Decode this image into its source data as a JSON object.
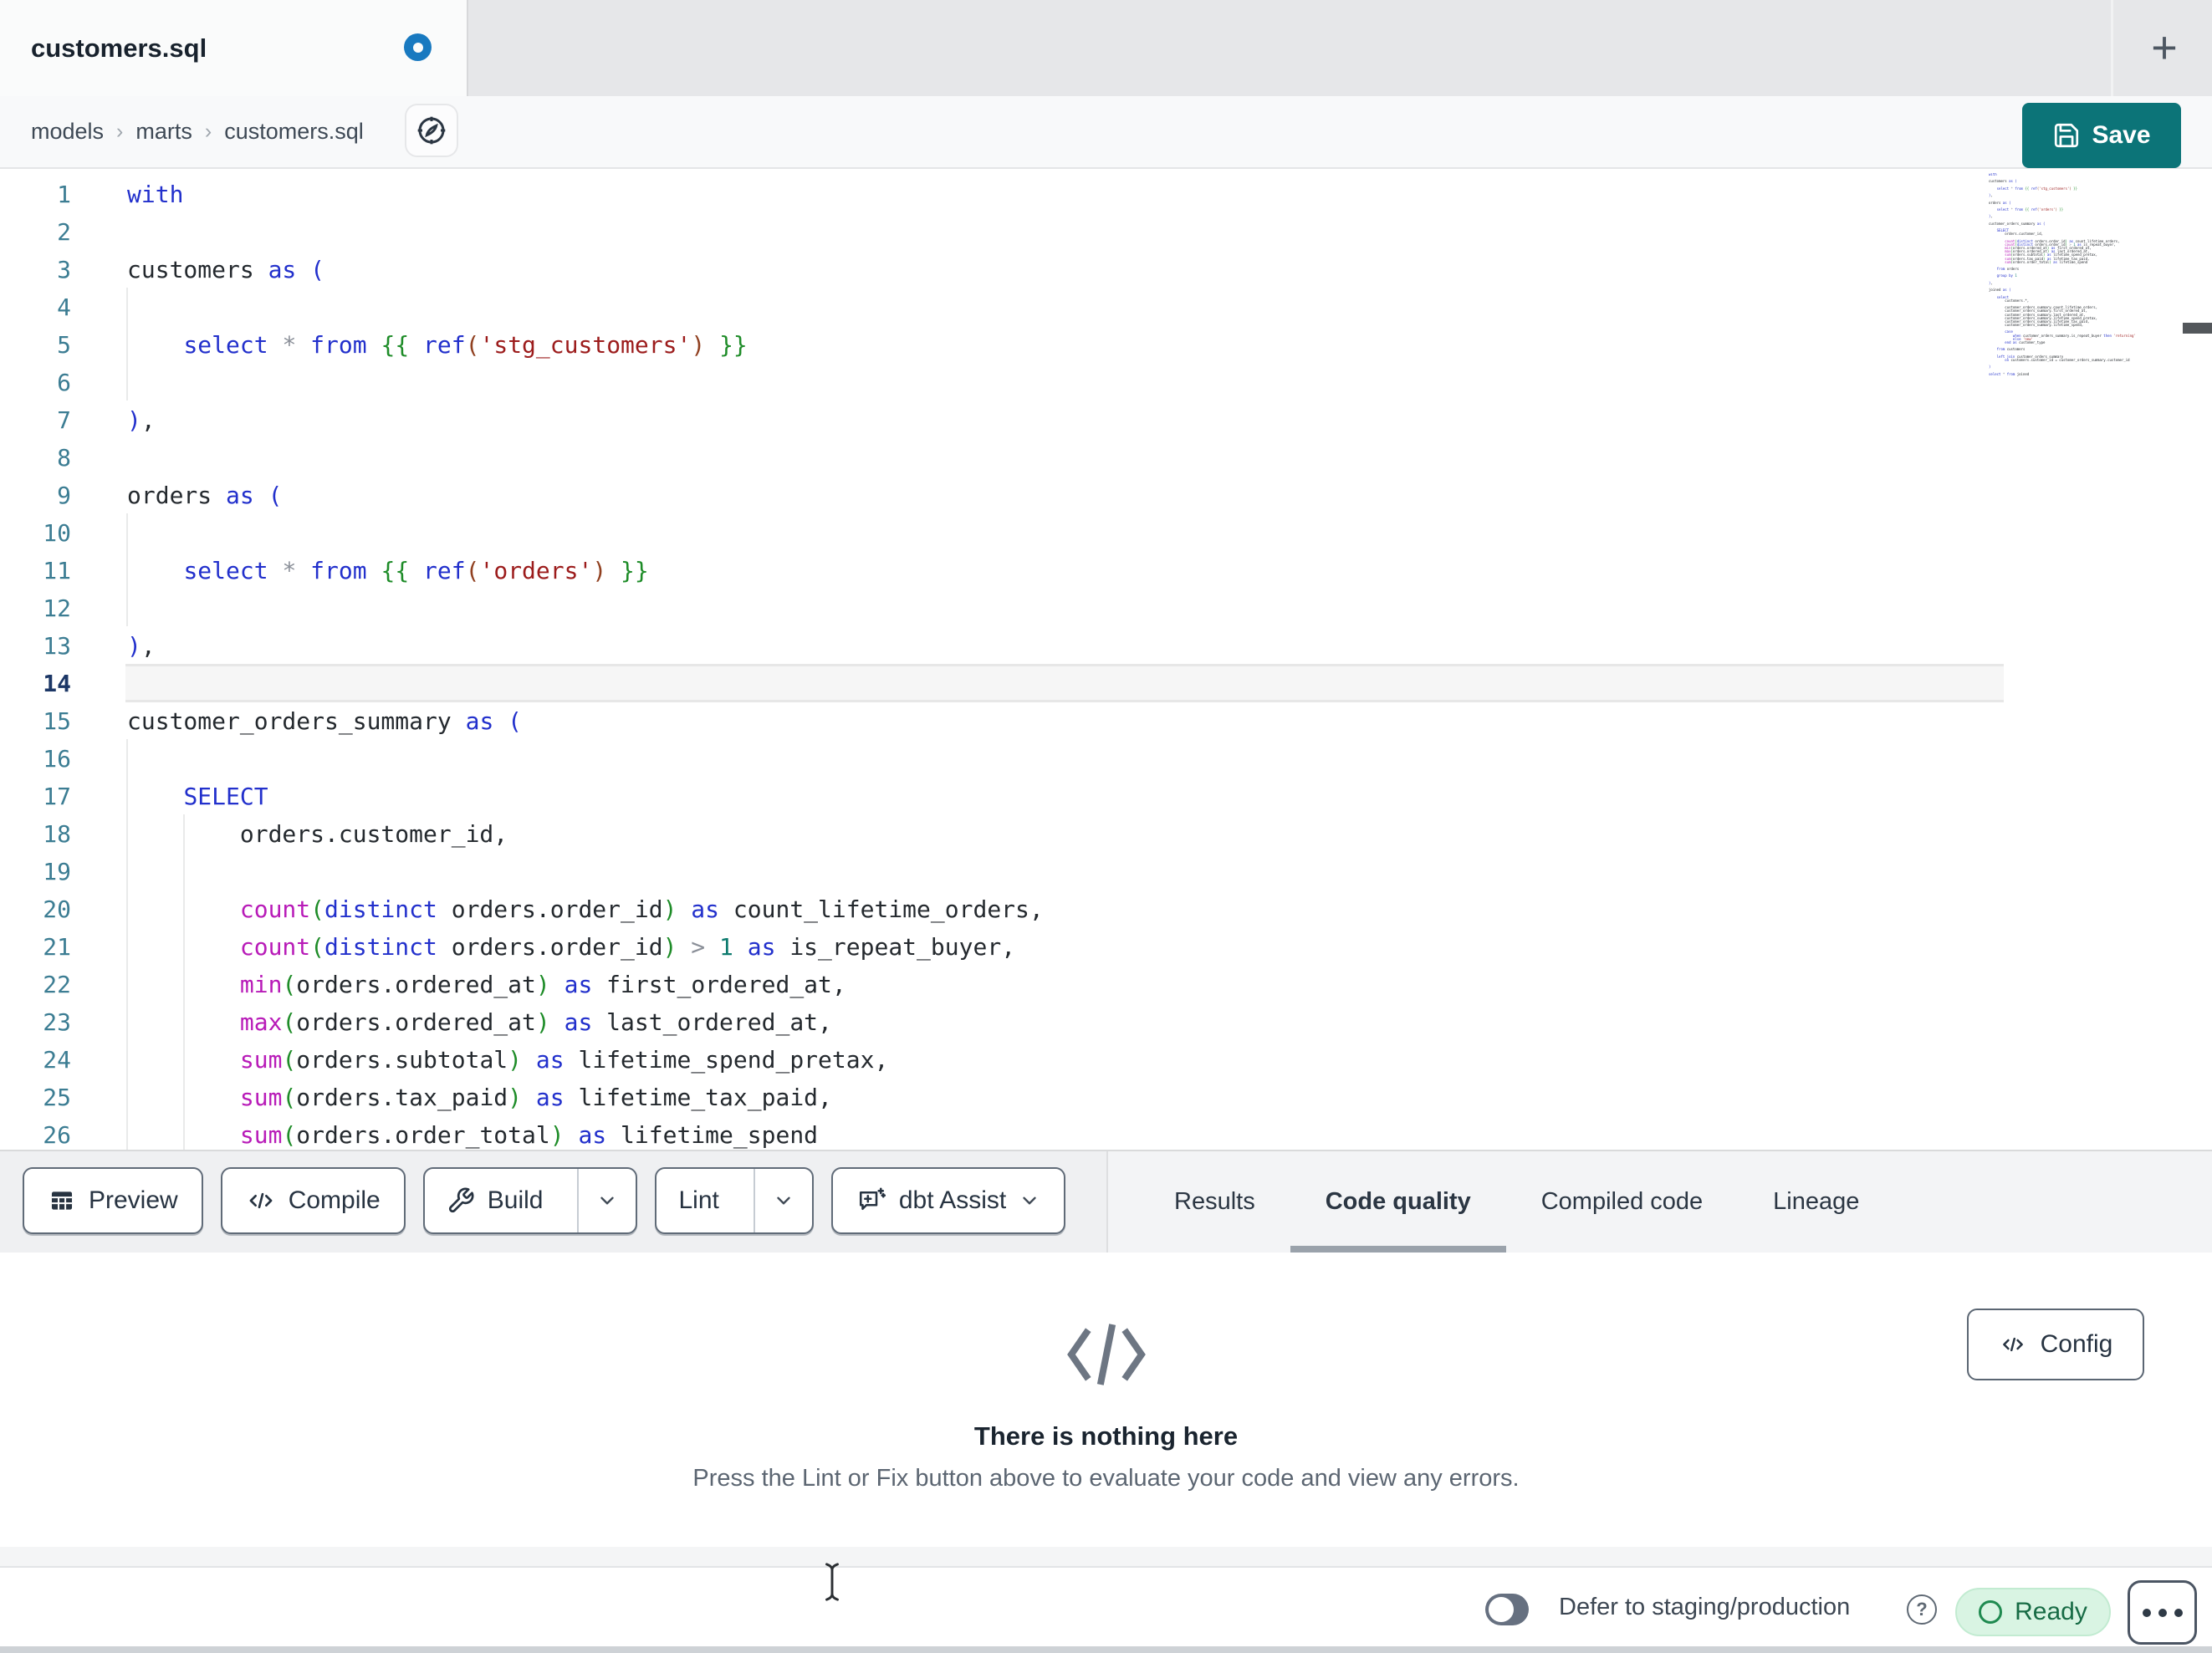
{
  "window": {
    "tab_title": "customers.sql",
    "tab_unsaved": true,
    "new_tab_label": "+"
  },
  "breadcrumb": {
    "items": [
      "models",
      "marts",
      "customers.sql"
    ],
    "separator": "›"
  },
  "header": {
    "save_label": "Save"
  },
  "editor": {
    "active_line": 14,
    "lines": [
      [
        [
          "k",
          "with"
        ]
      ],
      [],
      [
        [
          "t",
          "customers"
        ],
        [
          "k",
          " as ("
        ]
      ],
      [],
      [
        [
          "t",
          "    "
        ],
        [
          "k",
          "select"
        ],
        [
          "o",
          " * "
        ],
        [
          "k",
          "from"
        ],
        [
          "j",
          " {{ "
        ],
        [
          "k",
          "ref"
        ],
        [
          "b",
          "("
        ],
        [
          "s",
          "'stg_customers'"
        ],
        [
          "b",
          ")"
        ],
        [
          "j",
          " }}"
        ]
      ],
      [],
      [
        [
          "k",
          ")"
        ],
        [
          "t",
          ","
        ]
      ],
      [],
      [
        [
          "t",
          "orders"
        ],
        [
          "k",
          " as ("
        ]
      ],
      [],
      [
        [
          "t",
          "    "
        ],
        [
          "k",
          "select"
        ],
        [
          "o",
          " * "
        ],
        [
          "k",
          "from"
        ],
        [
          "j",
          " {{ "
        ],
        [
          "k",
          "ref"
        ],
        [
          "b",
          "("
        ],
        [
          "s",
          "'orders'"
        ],
        [
          "b",
          ")"
        ],
        [
          "j",
          " }}"
        ]
      ],
      [],
      [
        [
          "k",
          ")"
        ],
        [
          "t",
          ","
        ]
      ],
      [],
      [
        [
          "t",
          "customer_orders_summary"
        ],
        [
          "k",
          " as ("
        ]
      ],
      [],
      [
        [
          "t",
          "    "
        ],
        [
          "k",
          "SELECT"
        ]
      ],
      [
        [
          "t",
          "        orders.customer_id,"
        ]
      ],
      [],
      [
        [
          "t",
          "        "
        ],
        [
          "f",
          "count"
        ],
        [
          "g",
          "("
        ],
        [
          "k",
          "distinct"
        ],
        [
          "t",
          " orders.order_id"
        ],
        [
          "g",
          ")"
        ],
        [
          "k",
          " as"
        ],
        [
          "t",
          " count_lifetime_orders,"
        ]
      ],
      [
        [
          "t",
          "        "
        ],
        [
          "f",
          "count"
        ],
        [
          "g",
          "("
        ],
        [
          "k",
          "distinct"
        ],
        [
          "t",
          " orders.order_id"
        ],
        [
          "g",
          ")"
        ],
        [
          "o",
          " > "
        ],
        [
          "n",
          "1"
        ],
        [
          "k",
          " as"
        ],
        [
          "t",
          " is_repeat_buyer,"
        ]
      ],
      [
        [
          "t",
          "        "
        ],
        [
          "f",
          "min"
        ],
        [
          "g",
          "("
        ],
        [
          "t",
          "orders.ordered_at"
        ],
        [
          "g",
          ")"
        ],
        [
          "k",
          " as"
        ],
        [
          "t",
          " first_ordered_at,"
        ]
      ],
      [
        [
          "t",
          "        "
        ],
        [
          "f",
          "max"
        ],
        [
          "g",
          "("
        ],
        [
          "t",
          "orders.ordered_at"
        ],
        [
          "g",
          ")"
        ],
        [
          "k",
          " as"
        ],
        [
          "t",
          " last_ordered_at,"
        ]
      ],
      [
        [
          "t",
          "        "
        ],
        [
          "f",
          "sum"
        ],
        [
          "g",
          "("
        ],
        [
          "t",
          "orders.subtotal"
        ],
        [
          "g",
          ")"
        ],
        [
          "k",
          " as"
        ],
        [
          "t",
          " lifetime_spend_pretax,"
        ]
      ],
      [
        [
          "t",
          "        "
        ],
        [
          "f",
          "sum"
        ],
        [
          "g",
          "("
        ],
        [
          "t",
          "orders.tax_paid"
        ],
        [
          "g",
          ")"
        ],
        [
          "k",
          " as"
        ],
        [
          "t",
          " lifetime_tax_paid,"
        ]
      ],
      [
        [
          "t",
          "        "
        ],
        [
          "f",
          "sum"
        ],
        [
          "g",
          "("
        ],
        [
          "t",
          "orders.order_total"
        ],
        [
          "g",
          ")"
        ],
        [
          "k",
          " as"
        ],
        [
          "t",
          " lifetime_spend"
        ]
      ]
    ],
    "minimap_extra_lines": [
      [],
      [
        [
          "t",
          "    "
        ],
        [
          "k",
          "from"
        ],
        [
          "t",
          " orders"
        ]
      ],
      [],
      [
        [
          "t",
          "    "
        ],
        [
          "k",
          "group by"
        ],
        [
          "n",
          " 1"
        ]
      ],
      [],
      [
        [
          "k",
          ")"
        ],
        [
          "t",
          ","
        ]
      ],
      [],
      [
        [
          "t",
          "joined"
        ],
        [
          "k",
          " as ("
        ]
      ],
      [],
      [
        [
          "t",
          "    "
        ],
        [
          "k",
          "select"
        ]
      ],
      [
        [
          "t",
          "        customers.*,"
        ]
      ],
      [],
      [
        [
          "t",
          "        customer_orders_summary.count_lifetime_orders,"
        ]
      ],
      [
        [
          "t",
          "        customer_orders_summary.first_ordered_at,"
        ]
      ],
      [
        [
          "t",
          "        customer_orders_summary.last_ordered_at,"
        ]
      ],
      [
        [
          "t",
          "        customer_orders_summary.lifetime_spend_pretax,"
        ]
      ],
      [
        [
          "t",
          "        customer_orders_summary.lifetime_tax_paid,"
        ]
      ],
      [
        [
          "t",
          "        customer_orders_summary.lifetime_spend,"
        ]
      ],
      [],
      [
        [
          "t",
          "        "
        ],
        [
          "k",
          "case"
        ]
      ],
      [
        [
          "t",
          "            "
        ],
        [
          "k",
          "when"
        ],
        [
          "t",
          " customer_orders_summary.is_repeat_buyer "
        ],
        [
          "k",
          "then"
        ],
        [
          "s",
          " 'returning'"
        ]
      ],
      [
        [
          "t",
          "            "
        ],
        [
          "k",
          "else"
        ],
        [
          "s",
          " 'new'"
        ]
      ],
      [
        [
          "t",
          "        "
        ],
        [
          "k",
          "end as"
        ],
        [
          "t",
          " customer_type"
        ]
      ],
      [],
      [
        [
          "t",
          "    "
        ],
        [
          "k",
          "from"
        ],
        [
          "t",
          " customers"
        ]
      ],
      [],
      [
        [
          "t",
          "    "
        ],
        [
          "k",
          "left join"
        ],
        [
          "t",
          " customer_orders_summary"
        ]
      ],
      [
        [
          "t",
          "        "
        ],
        [
          "k",
          "on"
        ],
        [
          "t",
          " customers.customer_id = customer_orders_summary.customer_id"
        ]
      ],
      [],
      [
        [
          "k",
          ")"
        ]
      ],
      [],
      [
        [
          "k",
          "select"
        ],
        [
          "o",
          " * "
        ],
        [
          "k",
          "from"
        ],
        [
          "t",
          " joined"
        ]
      ]
    ]
  },
  "toolbar": {
    "preview_label": "Preview",
    "compile_label": "Compile",
    "build_label": "Build",
    "lint_label": "Lint",
    "assist_label": "dbt Assist"
  },
  "results_panel": {
    "tabs": [
      {
        "label": "Results",
        "active": false
      },
      {
        "label": "Code quality",
        "active": true
      },
      {
        "label": "Compiled code",
        "active": false
      },
      {
        "label": "Lineage",
        "active": false
      }
    ],
    "config_label": "Config",
    "empty_title": "There is nothing here",
    "empty_subtitle": "Press the Lint or Fix button above to evaluate your code and view any errors."
  },
  "statusbar": {
    "defer_label": "Defer to staging/production",
    "defer_toggle_on": false,
    "help_glyph": "?",
    "status_label": "Ready"
  },
  "icons": {
    "save": "floppy-disk",
    "preview": "table",
    "compile": "code-brackets",
    "build": "wrench",
    "assist": "chat-sparkle",
    "config": "code-brackets",
    "empty_state": "code-brackets",
    "breadcrumb_action": "compass",
    "help": "question-circle",
    "overflow": "ellipsis",
    "new_tab": "plus",
    "unsaved_indicator": "dot"
  },
  "colors": {
    "accent_teal": "#0c7478",
    "unsaved_dot": "#1879c0",
    "ready_bg": "#d9f4e3",
    "ready_text": "#176b45",
    "keyword": "#2230cc",
    "function": "#b81bb8",
    "string": "#9c1c1c",
    "jinja": "#1e8c28",
    "number": "#0e7b6f"
  }
}
